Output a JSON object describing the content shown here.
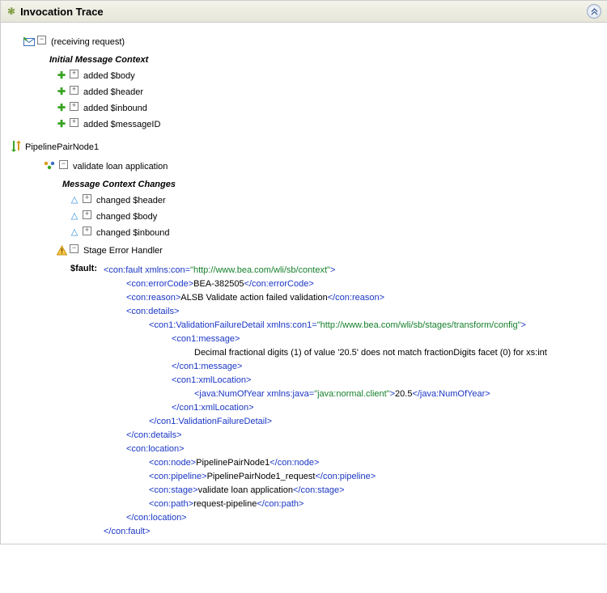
{
  "title": "Invocation Trace",
  "root": {
    "label": "(receiving request)"
  },
  "initial_section": "Initial Message Context",
  "initial_items": [
    "added $body",
    "added $header",
    "added $inbound",
    "added $messageID"
  ],
  "pipeline": {
    "label": "PipelinePairNode1"
  },
  "stage": {
    "label": "validate loan application"
  },
  "changes_section": "Message Context Changes",
  "changes": [
    "changed $header",
    "changed $body",
    "changed $inbound"
  ],
  "error_handler": "Stage Error Handler",
  "fault_label": "$fault:",
  "xml": {
    "ns_context": "http://www.bea.com/wli/sb/context",
    "error_code": "BEA-382505",
    "reason": "ALSB Validate action failed validation",
    "ns_transform": "http://www.bea.com/wli/sb/stages/transform/config",
    "message": "Decimal fractional digits (1) of value '20.5' does not match fractionDigits facet (0) for xs:int",
    "java_ns": "java:normal.client",
    "num_value": "20.5",
    "loc_node": "PipelinePairNode1",
    "loc_pipeline": "PipelinePairNode1_request",
    "loc_stage": "validate loan application",
    "loc_path": "request-pipeline"
  }
}
